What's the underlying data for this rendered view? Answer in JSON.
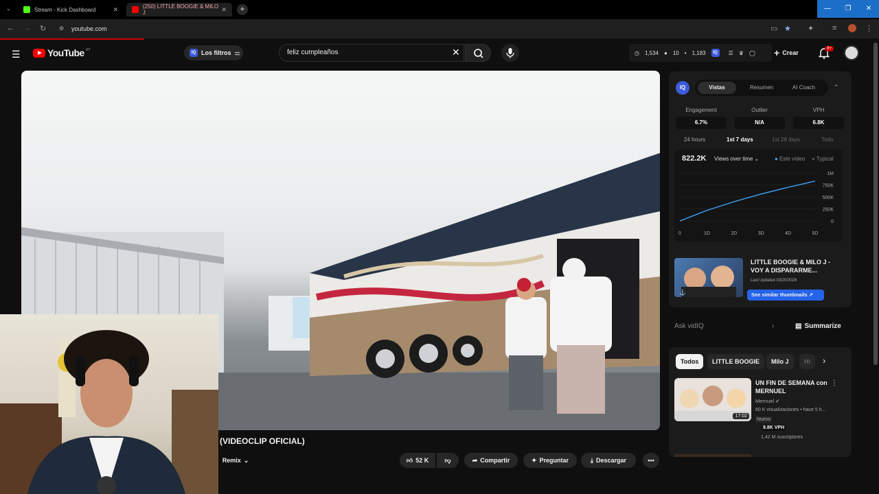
{
  "browser": {
    "tabs": [
      {
        "title": "Stream - Kick Dashboard",
        "favicon_color": "#53fc18"
      },
      {
        "title": "(250) LITTLE BOOGIE & MILO J",
        "favicon_color": "#ff0000"
      }
    ],
    "new_tab": "+",
    "url": "youtube.com"
  },
  "header": {
    "logo_text": "YouTube",
    "country": "UY",
    "filters_label": "Los filtros",
    "search_query": "feliz cumpleaños",
    "stats": {
      "views": "1,534",
      "likes": "10",
      "comments": "1,183"
    },
    "create_label": "Crear",
    "notif_count": "9+"
  },
  "video": {
    "title": "(VIDEOCLIP OFICIAL)",
    "remix_label": "Remix",
    "likes": "52 K",
    "share_label": "Compartir",
    "ask_label": "Preguntar",
    "download_label": "Descargar"
  },
  "vidiq": {
    "tabs": [
      "Vistas",
      "Resumen",
      "AI Coach"
    ],
    "metrics": [
      {
        "label": "Engagement",
        "value": "6.7%"
      },
      {
        "label": "Outlier",
        "value": "N/A"
      },
      {
        "label": "VPH",
        "value": "6.8K"
      }
    ],
    "ranges": [
      "24 hours",
      "1st 7 days",
      "1st 28 days",
      "Todo"
    ],
    "total_views": "822.2K",
    "views_dropdown": "Views over time",
    "legend": [
      "Este video",
      "Typical"
    ],
    "card_title": "LITTLE BOOGIE & MILO J - VOY A DISPARARME...",
    "card_updated": "Last Updated 03/20/2026",
    "card_button": "See similar thumbnails",
    "ask_placeholder": "Ask vidIQ",
    "summarize_label": "Summarize"
  },
  "chart_data": {
    "type": "line",
    "x": [
      "0",
      "1D",
      "2D",
      "3D",
      "4D",
      "5D"
    ],
    "series": [
      {
        "name": "Este video",
        "values": [
          0,
          220,
          400,
          560,
          700,
          830
        ]
      }
    ],
    "ylim": [
      0,
      1000
    ],
    "yticks": [
      "0",
      "250K",
      "500K",
      "750K",
      "1M"
    ],
    "color": "#3ea6ff"
  },
  "sidebar": {
    "chips": [
      "Todos",
      "LITTLE BOOGIE",
      "Milo J",
      "Hi"
    ],
    "video": {
      "title": "UN FIN DE SEMANA con MERNUEL",
      "channel": "Mernuel",
      "meta": "60 K visualizaciones • hace 5 h...",
      "badge": "Nuevo",
      "duration": "17:02",
      "vph": "9.8K VPH",
      "subs": "1,42 M suscriptores"
    }
  }
}
